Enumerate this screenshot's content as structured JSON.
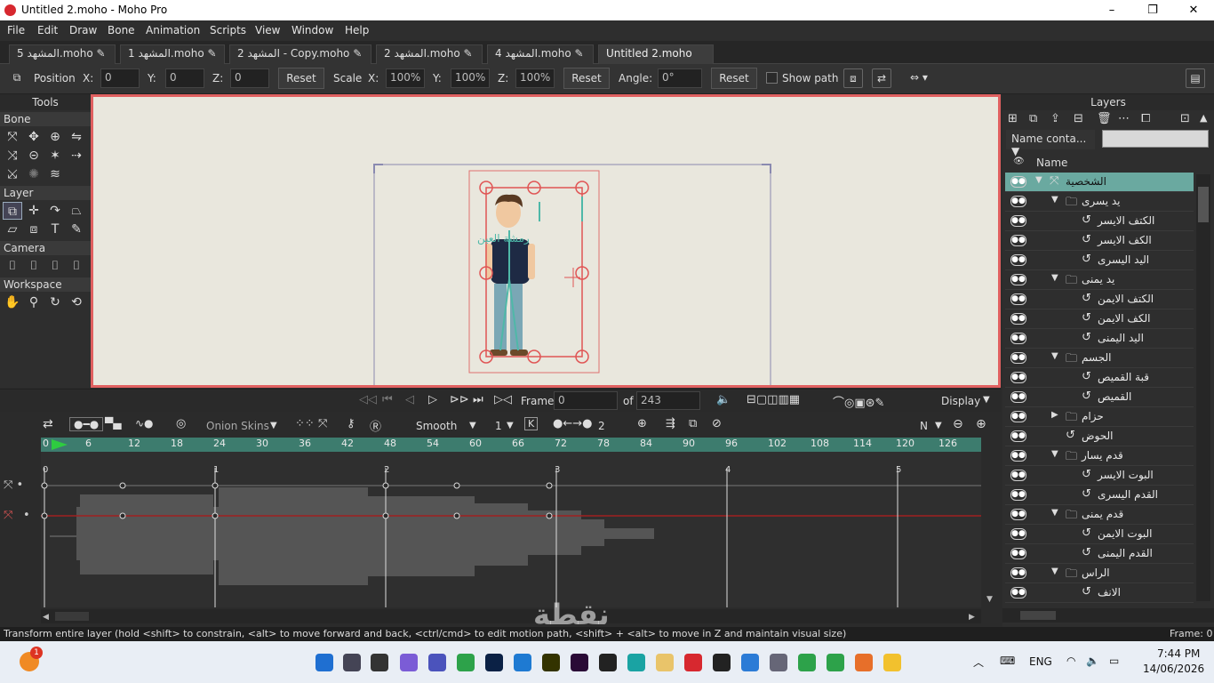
{
  "window": {
    "title": "Untitled 2.moho - Moho Pro",
    "controls": [
      "–",
      "❐",
      "✕"
    ]
  },
  "menu": [
    "File",
    "Edit",
    "Draw",
    "Bone",
    "Animation",
    "Scripts",
    "View",
    "Window",
    "Help"
  ],
  "tabs": [
    {
      "label": "المشهد 5.moho"
    },
    {
      "label": "المشهد 1.moho"
    },
    {
      "label": "المشهد 2 - Copy.moho"
    },
    {
      "label": "المشهد 2.moho"
    },
    {
      "label": "المشهد 4.moho"
    },
    {
      "label": "Untitled 2.moho",
      "active": true
    }
  ],
  "tool_options": {
    "position_label": "Position",
    "x_label": "X:",
    "x_value": "0",
    "y_label": "Y:",
    "y_value": "0",
    "z_label": "Z:",
    "z_value": "0",
    "reset1": "Reset",
    "scale_label": "Scale",
    "sx_label": "X:",
    "sx_value": "100%",
    "sy_label": "Y:",
    "sy_value": "100%",
    "sz_label": "Z:",
    "sz_value": "100%",
    "reset2": "Reset",
    "angle_label": "Angle:",
    "angle_value": "0°",
    "reset3": "Reset",
    "show_path": "Show path"
  },
  "tools": {
    "title": "Tools",
    "bone": "Bone",
    "layer": "Layer",
    "camera": "Camera",
    "workspace": "Workspace"
  },
  "canvas": {
    "char_label": "رمشة العين"
  },
  "framebar": {
    "frame_label": "Frame",
    "frame_value": "0",
    "of_label": "of",
    "total": "243",
    "display": "Display"
  },
  "timeline": {
    "onion": "Onion Skins",
    "interp": "Smooth",
    "interp_num": "1",
    "keys_num": "2",
    "n_label": "N",
    "ruler": [
      "0",
      "6",
      "12",
      "18",
      "24",
      "30",
      "36",
      "42",
      "48",
      "54",
      "60",
      "66",
      "72",
      "78",
      "84",
      "90",
      "96",
      "102",
      "108",
      "114",
      "120",
      "126"
    ],
    "seconds": [
      "0",
      "1",
      "2",
      "3",
      "4",
      "5"
    ]
  },
  "layers": {
    "title": "Layers",
    "filter": "Name conta...",
    "name_header": "Name",
    "rows": [
      {
        "name": "الشخصية",
        "type": "bone",
        "indent": 0,
        "selected": true
      },
      {
        "name": "يد يسرى",
        "type": "folder",
        "indent": 1
      },
      {
        "name": "الكتف الايسر",
        "type": "vector",
        "indent": 2
      },
      {
        "name": "الكف الايسر",
        "type": "vector",
        "indent": 2
      },
      {
        "name": "اليد اليسرى",
        "type": "vector",
        "indent": 2
      },
      {
        "name": "يد يمنى",
        "type": "folder",
        "indent": 1
      },
      {
        "name": "الكتف الايمن",
        "type": "vector",
        "indent": 2
      },
      {
        "name": "الكف الايمن",
        "type": "vector",
        "indent": 2
      },
      {
        "name": "اليد اليمنى",
        "type": "vector",
        "indent": 2
      },
      {
        "name": "الجسم",
        "type": "folder",
        "indent": 1
      },
      {
        "name": "قبة القميص",
        "type": "vector",
        "indent": 2
      },
      {
        "name": "القميص",
        "type": "vector",
        "indent": 2
      },
      {
        "name": "حزام",
        "type": "folder-closed",
        "indent": 1
      },
      {
        "name": "الحوض",
        "type": "vector",
        "indent": 1
      },
      {
        "name": "قدم يسار",
        "type": "folder",
        "indent": 1
      },
      {
        "name": "البوت الايسر",
        "type": "vector",
        "indent": 2
      },
      {
        "name": "القدم اليسرى",
        "type": "vector",
        "indent": 2
      },
      {
        "name": "قدم يمنى",
        "type": "folder",
        "indent": 1
      },
      {
        "name": "البوت الايمن",
        "type": "vector",
        "indent": 2
      },
      {
        "name": "القدم اليمنى",
        "type": "vector",
        "indent": 2
      },
      {
        "name": "الراس",
        "type": "folder",
        "indent": 1
      },
      {
        "name": "الانف",
        "type": "vector",
        "indent": 2
      }
    ]
  },
  "status": {
    "text": "Transform entire layer (hold <shift> to constrain, <alt> to move forward and back, <ctrl/cmd> to edit motion path, <shift> + <alt> to move in Z and maintain visual size)",
    "frame": "Frame: 0"
  },
  "watermark": "نقطة",
  "taskbar": {
    "lang": "ENG",
    "time": "7:44 PM",
    "date": "14/06/2026",
    "badge": "1"
  },
  "colors": {
    "accent_timeline": "#3d7c6e",
    "selected_layer": "#6aa9a0",
    "canvas_border": "#e06060",
    "bone_color": "#e05555"
  }
}
